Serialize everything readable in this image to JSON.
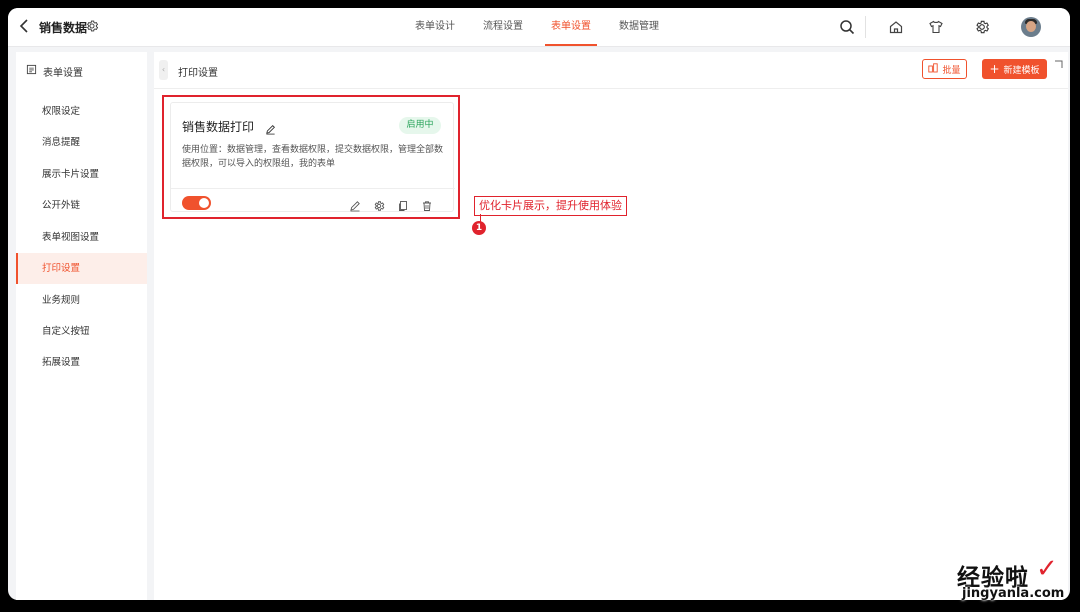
{
  "app": {
    "title": "销售数据"
  },
  "tabs": [
    {
      "label": "表单设计"
    },
    {
      "label": "流程设置"
    },
    {
      "label": "表单设置",
      "active": true
    },
    {
      "label": "数据管理"
    }
  ],
  "sidebar": {
    "header": "表单设置",
    "items": [
      {
        "label": "权限设定"
      },
      {
        "label": "消息提醒"
      },
      {
        "label": "展示卡片设置"
      },
      {
        "label": "公开外链"
      },
      {
        "label": "表单视图设置"
      },
      {
        "label": "打印设置",
        "active": true
      },
      {
        "label": "业务规则"
      },
      {
        "label": "自定义按钮"
      },
      {
        "label": "拓展设置"
      }
    ]
  },
  "main": {
    "title": "打印设置",
    "batch_label": "批量",
    "new_label": "新建模板"
  },
  "card": {
    "title": "销售数据打印",
    "status": "启用中",
    "description": "使用位置：数据管理，查看数据权限，提交数据权限，管理全部数据权限，可以导入的权限组，我的表单",
    "enabled": true
  },
  "annotation": {
    "text": "优化卡片展示，提升使用体验",
    "number": "1"
  },
  "watermark": {
    "main": "经验啦",
    "sub": "jingyanla.com",
    "check": "✓"
  },
  "colors": {
    "accent": "#f0522d",
    "annotation": "#e0232d",
    "status_green": "#2aa45b"
  }
}
